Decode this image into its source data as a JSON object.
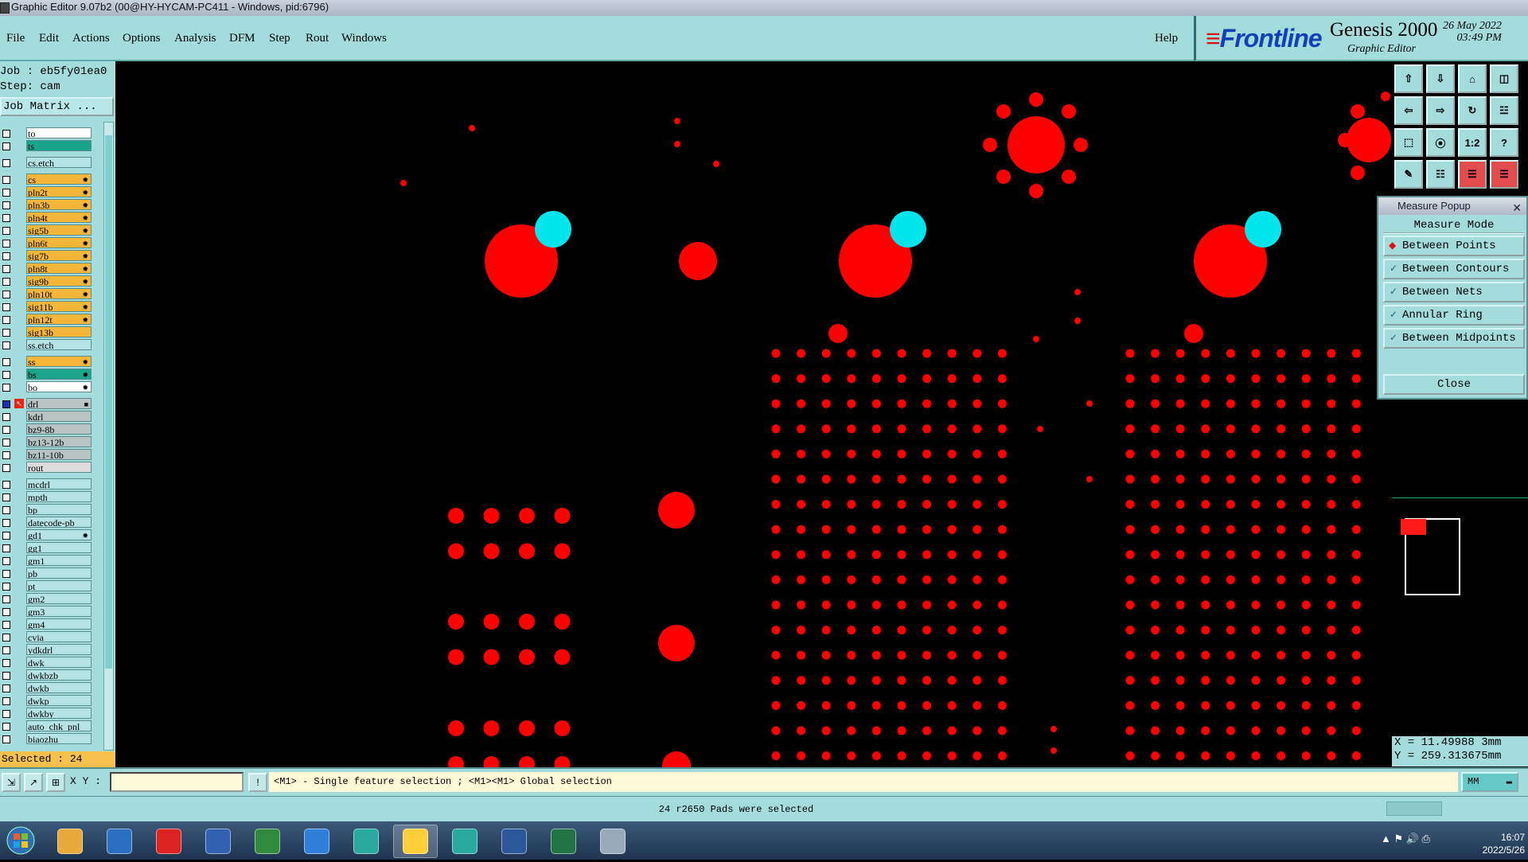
{
  "window": {
    "title": "Graphic Editor 9.07b2 (00@HY-HYCAM-PC411 - Windows, pid:6796)"
  },
  "menu": {
    "items": [
      "File",
      "Edit",
      "Actions",
      "Options",
      "Analysis",
      "DFM",
      "Step",
      "Rout",
      "Windows"
    ],
    "help": "Help"
  },
  "logo": {
    "brand": "Frontline",
    "product": "Genesis 2000",
    "subtitle": "Graphic Editor",
    "date": "26 May 2022",
    "time": "03:49 PM"
  },
  "job": {
    "job_line": "Job : eb5fy01ea0",
    "step_line": "Step: cam",
    "matrix_label": "Job Matrix ..."
  },
  "layers": [
    {
      "name": "to",
      "color": "#ffffff",
      "mark": ""
    },
    {
      "name": "ts",
      "color": "#1aa58a",
      "mark": ""
    },
    {
      "name": "cs.etch",
      "color": "#b6e3e3",
      "mark": ""
    },
    {
      "name": "cs",
      "color": "#f5b63a",
      "mark": "✹"
    },
    {
      "name": "pln2t",
      "color": "#f5b63a",
      "mark": "✹"
    },
    {
      "name": "pln3b",
      "color": "#f5b63a",
      "mark": "✹"
    },
    {
      "name": "pln4t",
      "color": "#f5b63a",
      "mark": "✹"
    },
    {
      "name": "sig5b",
      "color": "#f5b63a",
      "mark": "✹"
    },
    {
      "name": "pln6t",
      "color": "#f5b63a",
      "mark": "✹"
    },
    {
      "name": "sig7b",
      "color": "#f5b63a",
      "mark": "✹"
    },
    {
      "name": "pln8t",
      "color": "#f5b63a",
      "mark": "✹"
    },
    {
      "name": "sig9b",
      "color": "#f5b63a",
      "mark": "✹"
    },
    {
      "name": "pln10t",
      "color": "#f5b63a",
      "mark": "✹"
    },
    {
      "name": "sig11b",
      "color": "#f5b63a",
      "mark": "✹"
    },
    {
      "name": "pln12t",
      "color": "#f5b63a",
      "mark": "✹"
    },
    {
      "name": "sig13b",
      "color": "#f5b63a",
      "mark": ""
    },
    {
      "name": "ss.etch",
      "color": "#b6e3e3",
      "mark": ""
    },
    {
      "name": "ss",
      "color": "#f5b63a",
      "mark": "✹"
    },
    {
      "name": "bs",
      "color": "#1aa58a",
      "mark": "✹"
    },
    {
      "name": "bo",
      "color": "#ffffff",
      "mark": "✹"
    },
    {
      "name": "drl",
      "color": "#b8c4c4",
      "mark": "■"
    },
    {
      "name": "kdrl",
      "color": "#b8c4c4",
      "mark": ""
    },
    {
      "name": "bz9-8b",
      "color": "#b8c4c4",
      "mark": ""
    },
    {
      "name": "bz13-12b",
      "color": "#b8c4c4",
      "mark": ""
    },
    {
      "name": "bz11-10b",
      "color": "#b8c4c4",
      "mark": ""
    },
    {
      "name": "rout",
      "color": "#dcdcdc",
      "mark": ""
    },
    {
      "name": "mcdrl",
      "color": "#b6e3e3",
      "mark": ""
    },
    {
      "name": "mpth",
      "color": "#b6e3e3",
      "mark": ""
    },
    {
      "name": "bp",
      "color": "#b6e3e3",
      "mark": ""
    },
    {
      "name": "datecode-pb",
      "color": "#b6e3e3",
      "mark": ""
    },
    {
      "name": "gd1",
      "color": "#b6e3e3",
      "mark": "✹"
    },
    {
      "name": "gg1",
      "color": "#b6e3e3",
      "mark": ""
    },
    {
      "name": "gm1",
      "color": "#b6e3e3",
      "mark": ""
    },
    {
      "name": "pb",
      "color": "#b6e3e3",
      "mark": ""
    },
    {
      "name": "pt",
      "color": "#b6e3e3",
      "mark": ""
    },
    {
      "name": "gm2",
      "color": "#b6e3e3",
      "mark": ""
    },
    {
      "name": "gm3",
      "color": "#b6e3e3",
      "mark": ""
    },
    {
      "name": "gm4",
      "color": "#b6e3e3",
      "mark": ""
    },
    {
      "name": "cvia",
      "color": "#b6e3e3",
      "mark": ""
    },
    {
      "name": "ydkdrl",
      "color": "#b6e3e3",
      "mark": ""
    },
    {
      "name": "dwk",
      "color": "#b6e3e3",
      "mark": ""
    },
    {
      "name": "dwkbzb",
      "color": "#b6e3e3",
      "mark": ""
    },
    {
      "name": "dwkb",
      "color": "#b6e3e3",
      "mark": ""
    },
    {
      "name": "dwkp",
      "color": "#b6e3e3",
      "mark": ""
    },
    {
      "name": "dwkby",
      "color": "#b6e3e3",
      "mark": ""
    },
    {
      "name": "auto_chk_pnl",
      "color": "#b6e3e3",
      "mark": ""
    },
    {
      "name": "biaozhu",
      "color": "#b6e3e3",
      "mark": ""
    }
  ],
  "selected_count": "Selected : 24",
  "measure_popup": {
    "title": "Measure Popup",
    "heading": "Measure Mode",
    "options": [
      "Between Points",
      "Between Contours",
      "Between Nets",
      "Annular Ring",
      "Between Midpoints"
    ],
    "selected": "Between Points",
    "close_label": "Close"
  },
  "toolbar_icons": [
    "zoom-home-icon",
    "zoom-out-icon",
    "home-icon",
    "split-view-icon",
    "pan-left-icon",
    "pan-right-icon",
    "rotate-icon",
    "snap-icon",
    "fit-icon",
    "center-icon",
    "one-to-one-icon",
    "help-icon",
    "measure-icon",
    "grid-icon",
    "layer-compare-icon",
    "layer-config-icon"
  ],
  "toolbar_labels": {
    "one_to_one": "1:2",
    "help": "?"
  },
  "coords": {
    "x": "X = 11.49988 3mm",
    "y": "Y = 259.313675mm"
  },
  "cmd": {
    "xy_label": "X Y :",
    "xy_value": "",
    "hint": "<M1> - Single feature selection ; <M1><M1> Global selection",
    "unit": "MM"
  },
  "status": "24 r2650 Pads were selected",
  "taskbar": {
    "time": "16:07",
    "date": "2022/5/26",
    "apps": [
      "shell-icon",
      "notepad-icon",
      "redswirl-icon",
      "save-disk-icon",
      "genesis-p-icon",
      "feather-icon",
      "eye-icon",
      "genesis-x-icon",
      "eye-icon-2",
      "word-icon",
      "excel-icon",
      "paper-icon"
    ]
  },
  "colors": {
    "accent": "#a4dcdc",
    "feature": "#ff0000",
    "highlight": "#00e5ec"
  }
}
